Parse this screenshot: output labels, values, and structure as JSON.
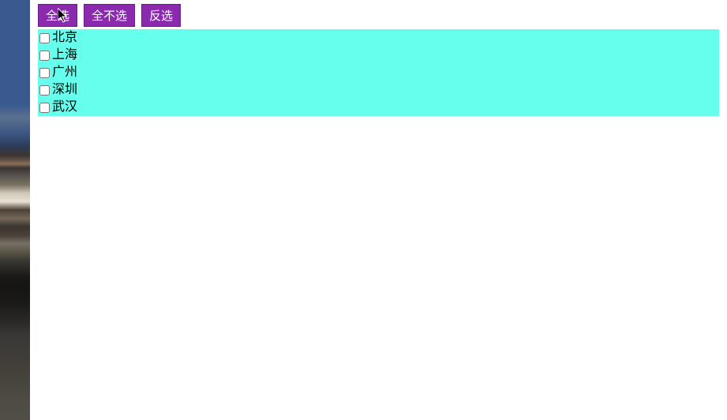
{
  "buttons": {
    "select_all": "全选",
    "select_none": "全不选",
    "invert": "反选"
  },
  "items": [
    {
      "label": "北京",
      "checked": false
    },
    {
      "label": "上海",
      "checked": false
    },
    {
      "label": "广州",
      "checked": false
    },
    {
      "label": "深圳",
      "checked": false
    },
    {
      "label": "武汉",
      "checked": false
    }
  ]
}
